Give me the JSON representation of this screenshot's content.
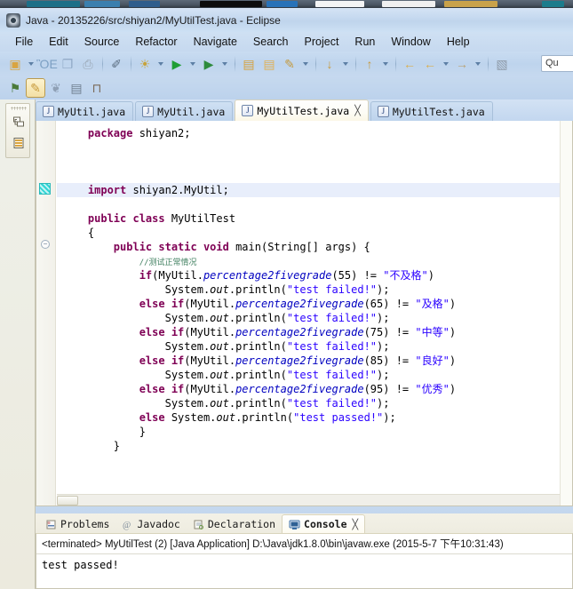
{
  "window": {
    "title": "Java - 20135226/src/shiyan2/MyUtilTest.java - Eclipse",
    "app_icon": "eclipse-icon"
  },
  "menubar": {
    "items": [
      {
        "label": "File"
      },
      {
        "label": "Edit"
      },
      {
        "label": "Source"
      },
      {
        "label": "Refactor"
      },
      {
        "label": "Navigate"
      },
      {
        "label": "Search"
      },
      {
        "label": "Project"
      },
      {
        "label": "Run"
      },
      {
        "label": "Window"
      },
      {
        "label": "Help"
      }
    ]
  },
  "toolbar": {
    "quick_access": "Qu",
    "row1": [
      {
        "name": "new-wizard-icon",
        "glyph": "▣",
        "color": "#d9a441",
        "arrow": true
      },
      {
        "name": "save-icon",
        "glyph": "ὋE",
        "color": "#7da0c4",
        "arrow": false
      },
      {
        "name": "save-all-icon",
        "glyph": "❐",
        "color": "#8fa8c6",
        "arrow": false
      },
      {
        "name": "print-icon",
        "glyph": "⎙",
        "color": "#9aa7b5",
        "arrow": false
      },
      {
        "sep": true
      },
      {
        "name": "toggle-mark-occurrences-icon",
        "glyph": "✐",
        "color": "#5b6d80",
        "arrow": false
      },
      {
        "sep": true
      },
      {
        "name": "debug-icon",
        "glyph": "☀",
        "color": "#c7a33a",
        "arrow": true
      },
      {
        "name": "run-icon",
        "glyph": "▶",
        "color": "#1f9e35",
        "arrow": true
      },
      {
        "name": "run-coverage-icon",
        "glyph": "▶",
        "color": "#2e8b3d",
        "arrow": true
      },
      {
        "sep": true
      },
      {
        "name": "new-java-package-icon",
        "glyph": "▤",
        "color": "#d6a13c",
        "arrow": false
      },
      {
        "name": "open-type-icon",
        "glyph": "▤",
        "color": "#e0b054",
        "arrow": false
      },
      {
        "name": "new-java-class-icon",
        "glyph": "✎",
        "color": "#c49a3f",
        "arrow": true
      },
      {
        "sep": true
      },
      {
        "name": "next-annotation-icon",
        "glyph": "↓",
        "color": "#c79a3c",
        "arrow": true
      },
      {
        "sep": true
      },
      {
        "name": "previous-annotation-icon",
        "glyph": "↑",
        "color": "#c79a3c",
        "arrow": true
      },
      {
        "sep": true
      },
      {
        "name": "back-icon",
        "glyph": "←",
        "color": "#d9ae4c",
        "arrow": false
      },
      {
        "name": "forward-icon",
        "glyph": "←",
        "color": "#d9ae4c",
        "arrow": true
      },
      {
        "name": "last-edit-location-icon",
        "glyph": "→",
        "color": "#b9a374",
        "arrow": true
      },
      {
        "sep": true
      },
      {
        "name": "open-perspective-icon",
        "glyph": "▧",
        "color": "#8e9aa8",
        "arrow": false
      }
    ],
    "row2": [
      {
        "name": "java-browsing-perspective-icon",
        "glyph": "⚑",
        "color": "#4a7a3a",
        "pressed": false
      },
      {
        "name": "java-perspective-icon",
        "glyph": "✎",
        "color": "#c79a3c",
        "pressed": true
      },
      {
        "name": "java-type-hierarchy-icon",
        "glyph": "❦",
        "color": "#8fa0b5",
        "pressed": false
      },
      {
        "name": "java-ee-perspective-icon",
        "glyph": "▤",
        "color": "#6f7f90",
        "pressed": false
      },
      {
        "name": "debug-perspective-icon",
        "glyph": "⊓",
        "color": "#7b6b5a",
        "pressed": false
      }
    ]
  },
  "fastview": {
    "items": [
      {
        "name": "package-explorer-icon",
        "glyph": "❐"
      },
      {
        "name": "hierarchy-view-icon",
        "glyph": "▤"
      }
    ]
  },
  "editor": {
    "tabs": [
      {
        "label": "MyUtil.java",
        "active": false,
        "dirty": false,
        "closable": false
      },
      {
        "label": "MyUtil.java",
        "active": false,
        "dirty": false,
        "closable": false
      },
      {
        "label": "MyUtilTest.java",
        "active": true,
        "dirty": false,
        "closable": true
      },
      {
        "label": "MyUtilTest.java",
        "active": false,
        "dirty": false,
        "closable": false
      }
    ],
    "close_glyph": "╳",
    "code_lines": [
      {
        "indent": 1,
        "highlight": false,
        "tokens": [
          {
            "t": "kw",
            "v": "package"
          },
          {
            "t": "",
            "v": " shiyan2;"
          }
        ]
      },
      {
        "indent": 0,
        "highlight": false,
        "tokens": []
      },
      {
        "indent": 0,
        "highlight": false,
        "tokens": []
      },
      {
        "indent": 0,
        "highlight": false,
        "tokens": []
      },
      {
        "indent": 1,
        "highlight": true,
        "tokens": [
          {
            "t": "kw",
            "v": "import"
          },
          {
            "t": "",
            "v": " shiyan2.MyUtil;"
          }
        ]
      },
      {
        "indent": 0,
        "highlight": false,
        "tokens": []
      },
      {
        "indent": 1,
        "highlight": false,
        "tokens": [
          {
            "t": "kw",
            "v": "public class"
          },
          {
            "t": "",
            "v": " MyUtilTest"
          }
        ]
      },
      {
        "indent": 1,
        "highlight": false,
        "tokens": [
          {
            "t": "",
            "v": "{"
          }
        ]
      },
      {
        "indent": 2,
        "highlight": false,
        "tokens": [
          {
            "t": "kw",
            "v": "public static void"
          },
          {
            "t": "",
            "v": " main(String[] args) {"
          }
        ]
      },
      {
        "indent": 3,
        "highlight": false,
        "tokens": [
          {
            "t": "cmt",
            "v": "//测试正常情况"
          }
        ]
      },
      {
        "indent": 3,
        "highlight": false,
        "tokens": [
          {
            "t": "kw",
            "v": "if"
          },
          {
            "t": "",
            "v": "(MyUtil."
          },
          {
            "t": "fld",
            "v": "percentage2fivegrade"
          },
          {
            "t": "",
            "v": "(55) != "
          },
          {
            "t": "str",
            "v": "\"不及格\""
          },
          {
            "t": "",
            "v": ")"
          }
        ]
      },
      {
        "indent": 4,
        "highlight": false,
        "tokens": [
          {
            "t": "",
            "v": "System."
          },
          {
            "t": "stat",
            "v": "out"
          },
          {
            "t": "",
            "v": ".println("
          },
          {
            "t": "str",
            "v": "\"test failed!\""
          },
          {
            "t": "",
            "v": ");"
          }
        ]
      },
      {
        "indent": 3,
        "highlight": false,
        "tokens": [
          {
            "t": "kw",
            "v": "else if"
          },
          {
            "t": "",
            "v": "(MyUtil."
          },
          {
            "t": "fld",
            "v": "percentage2fivegrade"
          },
          {
            "t": "",
            "v": "(65) != "
          },
          {
            "t": "str",
            "v": "\"及格\""
          },
          {
            "t": "",
            "v": ")"
          }
        ]
      },
      {
        "indent": 4,
        "highlight": false,
        "tokens": [
          {
            "t": "",
            "v": "System."
          },
          {
            "t": "stat",
            "v": "out"
          },
          {
            "t": "",
            "v": ".println("
          },
          {
            "t": "str",
            "v": "\"test failed!\""
          },
          {
            "t": "",
            "v": ");"
          }
        ]
      },
      {
        "indent": 3,
        "highlight": false,
        "tokens": [
          {
            "t": "kw",
            "v": "else if"
          },
          {
            "t": "",
            "v": "(MyUtil."
          },
          {
            "t": "fld",
            "v": "percentage2fivegrade"
          },
          {
            "t": "",
            "v": "(75) != "
          },
          {
            "t": "str",
            "v": "\"中等\""
          },
          {
            "t": "",
            "v": ")"
          }
        ]
      },
      {
        "indent": 4,
        "highlight": false,
        "tokens": [
          {
            "t": "",
            "v": "System."
          },
          {
            "t": "stat",
            "v": "out"
          },
          {
            "t": "",
            "v": ".println("
          },
          {
            "t": "str",
            "v": "\"test failed!\""
          },
          {
            "t": "",
            "v": ");"
          }
        ]
      },
      {
        "indent": 3,
        "highlight": false,
        "tokens": [
          {
            "t": "kw",
            "v": "else if"
          },
          {
            "t": "",
            "v": "(MyUtil."
          },
          {
            "t": "fld",
            "v": "percentage2fivegrade"
          },
          {
            "t": "",
            "v": "(85) != "
          },
          {
            "t": "str",
            "v": "\"良好\""
          },
          {
            "t": "",
            "v": ")"
          }
        ]
      },
      {
        "indent": 4,
        "highlight": false,
        "tokens": [
          {
            "t": "",
            "v": "System."
          },
          {
            "t": "stat",
            "v": "out"
          },
          {
            "t": "",
            "v": ".println("
          },
          {
            "t": "str",
            "v": "\"test failed!\""
          },
          {
            "t": "",
            "v": ");"
          }
        ]
      },
      {
        "indent": 3,
        "highlight": false,
        "tokens": [
          {
            "t": "kw",
            "v": "else if"
          },
          {
            "t": "",
            "v": "(MyUtil."
          },
          {
            "t": "fld",
            "v": "percentage2fivegrade"
          },
          {
            "t": "",
            "v": "(95) != "
          },
          {
            "t": "str",
            "v": "\"优秀\""
          },
          {
            "t": "",
            "v": ")"
          }
        ]
      },
      {
        "indent": 4,
        "highlight": false,
        "tokens": [
          {
            "t": "",
            "v": "System."
          },
          {
            "t": "stat",
            "v": "out"
          },
          {
            "t": "",
            "v": ".println("
          },
          {
            "t": "str",
            "v": "\"test failed!\""
          },
          {
            "t": "",
            "v": ");"
          }
        ]
      },
      {
        "indent": 3,
        "highlight": false,
        "tokens": [
          {
            "t": "kw",
            "v": "else"
          },
          {
            "t": "",
            "v": " System."
          },
          {
            "t": "stat",
            "v": "out"
          },
          {
            "t": "",
            "v": ".println("
          },
          {
            "t": "str",
            "v": "\"test passed!\""
          },
          {
            "t": "",
            "v": ");"
          }
        ]
      },
      {
        "indent": 3,
        "highlight": false,
        "tokens": [
          {
            "t": "",
            "v": "}"
          }
        ]
      },
      {
        "indent": 2,
        "highlight": false,
        "tokens": [
          {
            "t": "",
            "v": "}"
          }
        ]
      }
    ]
  },
  "console": {
    "tabs": [
      {
        "label": "Problems",
        "icon": "problems-icon",
        "active": false,
        "closable": false
      },
      {
        "label": "Javadoc",
        "icon": "javadoc-icon",
        "active": false,
        "closable": false
      },
      {
        "label": "Declaration",
        "icon": "declaration-icon",
        "active": false,
        "closable": false
      },
      {
        "label": "Console",
        "icon": "console-icon",
        "active": true,
        "closable": true
      }
    ],
    "close_glyph": "╳",
    "terminated_line": "<terminated> MyUtilTest (2) [Java Application] D:\\Java\\jdk1.8.0\\bin\\javaw.exe (2015-5-7 下午10:31:43)",
    "output": "test passed!"
  },
  "colors": {
    "titlebar": "#c9dcf1",
    "toolbar": "#c6d9ef",
    "editor_bg": "#ffffff",
    "highlight_line": "#e8eefb",
    "keyword": "#7f0055",
    "string": "#2a00ff",
    "comment": "#3f7f5f",
    "field": "#0000c0"
  }
}
